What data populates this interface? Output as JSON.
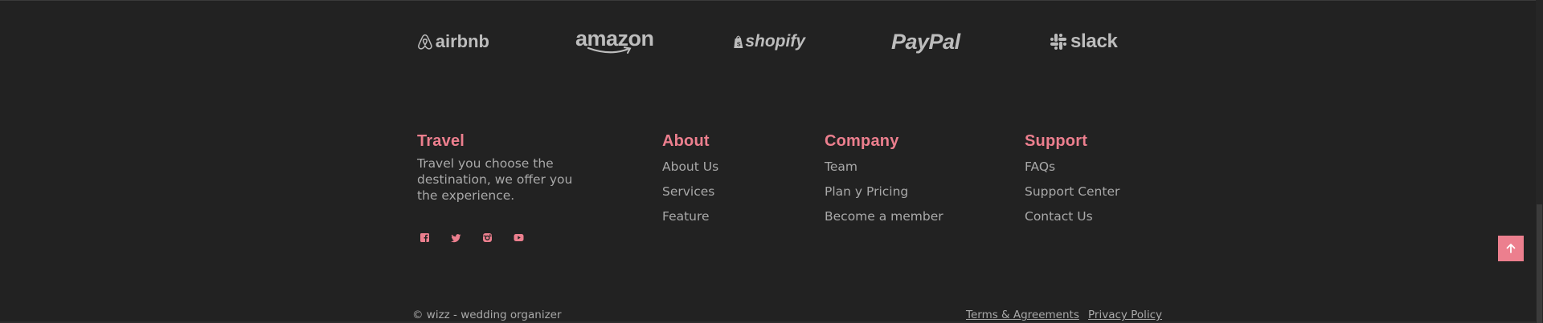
{
  "brands": [
    {
      "name": "airbnb",
      "icon": "airbnb-logo-icon"
    },
    {
      "name": "amazon",
      "icon": "amazon-logo-icon"
    },
    {
      "name": "shopify",
      "icon": "shopify-logo-icon"
    },
    {
      "name": "PayPal",
      "icon": "paypal-logo-icon"
    },
    {
      "name": "slack",
      "icon": "slack-logo-icon"
    }
  ],
  "travel": {
    "title": "Travel",
    "description": "Travel you choose the destination, we offer you the experience.",
    "social_icons": [
      "facebook-icon",
      "twitter-icon",
      "instagram-icon",
      "youtube-icon"
    ]
  },
  "about": {
    "title": "About",
    "links": [
      "About Us",
      "Services",
      "Feature"
    ]
  },
  "company": {
    "title": "Company",
    "links": [
      "Team",
      "Plan y Pricing",
      "Become a member"
    ]
  },
  "support": {
    "title": "Support",
    "links": [
      "FAQs",
      "Support Center",
      "Contact Us"
    ]
  },
  "footer": {
    "copyright": "© wizz - wedding organizer",
    "terms": "Terms & Agreements",
    "privacy": "Privacy Policy"
  },
  "colors": {
    "background": "#222222",
    "accent": "#ec7f8e",
    "text": "#a9a9a9"
  },
  "scroll_to_top": {
    "icon": "arrow-up-icon"
  }
}
